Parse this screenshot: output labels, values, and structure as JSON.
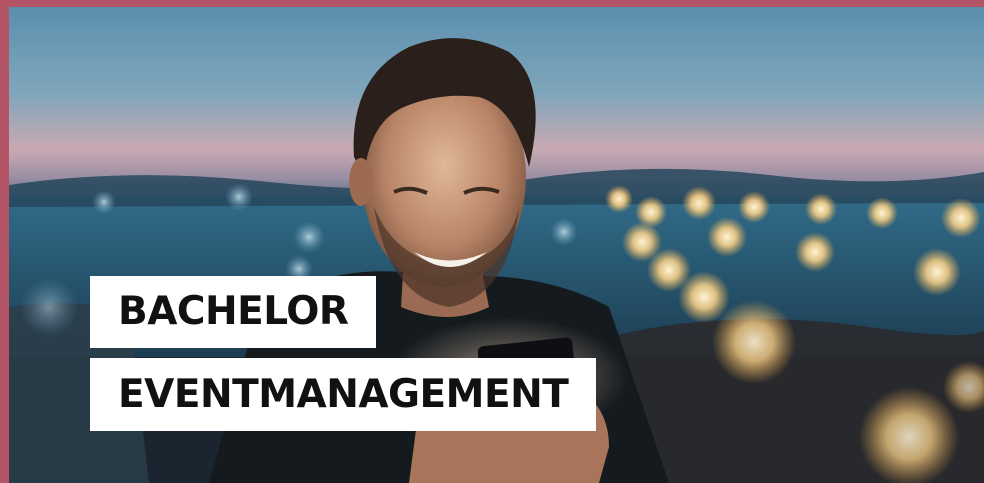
{
  "frame": {
    "border_color": "#b35467"
  },
  "hero": {
    "photo_subject": "smiling man looking at smartphone, evening coastline with bokeh lights",
    "caption": {
      "line_1": "BACHELOR",
      "line_2": "EVENTMANAGEMENT"
    },
    "caption_colors": {
      "background": "#ffffff",
      "text": "#111111"
    }
  }
}
